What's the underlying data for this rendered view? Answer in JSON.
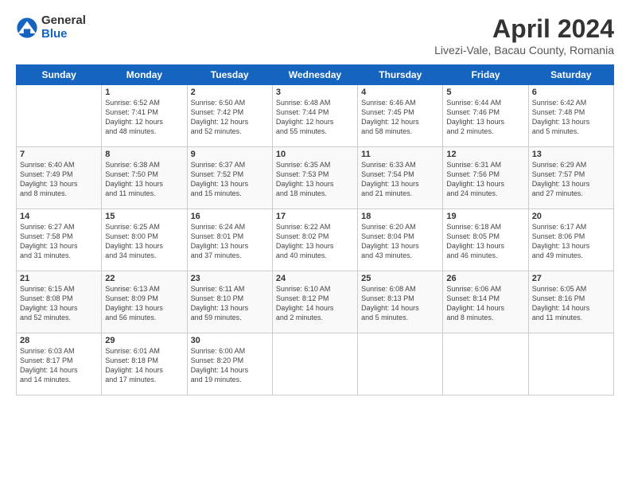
{
  "logo": {
    "general": "General",
    "blue": "Blue"
  },
  "title": "April 2024",
  "subtitle": "Livezi-Vale, Bacau County, Romania",
  "weekdays": [
    "Sunday",
    "Monday",
    "Tuesday",
    "Wednesday",
    "Thursday",
    "Friday",
    "Saturday"
  ],
  "weeks": [
    [
      {
        "day": "",
        "info": ""
      },
      {
        "day": "1",
        "info": "Sunrise: 6:52 AM\nSunset: 7:41 PM\nDaylight: 12 hours\nand 48 minutes."
      },
      {
        "day": "2",
        "info": "Sunrise: 6:50 AM\nSunset: 7:42 PM\nDaylight: 12 hours\nand 52 minutes."
      },
      {
        "day": "3",
        "info": "Sunrise: 6:48 AM\nSunset: 7:44 PM\nDaylight: 12 hours\nand 55 minutes."
      },
      {
        "day": "4",
        "info": "Sunrise: 6:46 AM\nSunset: 7:45 PM\nDaylight: 12 hours\nand 58 minutes."
      },
      {
        "day": "5",
        "info": "Sunrise: 6:44 AM\nSunset: 7:46 PM\nDaylight: 13 hours\nand 2 minutes."
      },
      {
        "day": "6",
        "info": "Sunrise: 6:42 AM\nSunset: 7:48 PM\nDaylight: 13 hours\nand 5 minutes."
      }
    ],
    [
      {
        "day": "7",
        "info": "Sunrise: 6:40 AM\nSunset: 7:49 PM\nDaylight: 13 hours\nand 8 minutes."
      },
      {
        "day": "8",
        "info": "Sunrise: 6:38 AM\nSunset: 7:50 PM\nDaylight: 13 hours\nand 11 minutes."
      },
      {
        "day": "9",
        "info": "Sunrise: 6:37 AM\nSunset: 7:52 PM\nDaylight: 13 hours\nand 15 minutes."
      },
      {
        "day": "10",
        "info": "Sunrise: 6:35 AM\nSunset: 7:53 PM\nDaylight: 13 hours\nand 18 minutes."
      },
      {
        "day": "11",
        "info": "Sunrise: 6:33 AM\nSunset: 7:54 PM\nDaylight: 13 hours\nand 21 minutes."
      },
      {
        "day": "12",
        "info": "Sunrise: 6:31 AM\nSunset: 7:56 PM\nDaylight: 13 hours\nand 24 minutes."
      },
      {
        "day": "13",
        "info": "Sunrise: 6:29 AM\nSunset: 7:57 PM\nDaylight: 13 hours\nand 27 minutes."
      }
    ],
    [
      {
        "day": "14",
        "info": "Sunrise: 6:27 AM\nSunset: 7:58 PM\nDaylight: 13 hours\nand 31 minutes."
      },
      {
        "day": "15",
        "info": "Sunrise: 6:25 AM\nSunset: 8:00 PM\nDaylight: 13 hours\nand 34 minutes."
      },
      {
        "day": "16",
        "info": "Sunrise: 6:24 AM\nSunset: 8:01 PM\nDaylight: 13 hours\nand 37 minutes."
      },
      {
        "day": "17",
        "info": "Sunrise: 6:22 AM\nSunset: 8:02 PM\nDaylight: 13 hours\nand 40 minutes."
      },
      {
        "day": "18",
        "info": "Sunrise: 6:20 AM\nSunset: 8:04 PM\nDaylight: 13 hours\nand 43 minutes."
      },
      {
        "day": "19",
        "info": "Sunrise: 6:18 AM\nSunset: 8:05 PM\nDaylight: 13 hours\nand 46 minutes."
      },
      {
        "day": "20",
        "info": "Sunrise: 6:17 AM\nSunset: 8:06 PM\nDaylight: 13 hours\nand 49 minutes."
      }
    ],
    [
      {
        "day": "21",
        "info": "Sunrise: 6:15 AM\nSunset: 8:08 PM\nDaylight: 13 hours\nand 52 minutes."
      },
      {
        "day": "22",
        "info": "Sunrise: 6:13 AM\nSunset: 8:09 PM\nDaylight: 13 hours\nand 56 minutes."
      },
      {
        "day": "23",
        "info": "Sunrise: 6:11 AM\nSunset: 8:10 PM\nDaylight: 13 hours\nand 59 minutes."
      },
      {
        "day": "24",
        "info": "Sunrise: 6:10 AM\nSunset: 8:12 PM\nDaylight: 14 hours\nand 2 minutes."
      },
      {
        "day": "25",
        "info": "Sunrise: 6:08 AM\nSunset: 8:13 PM\nDaylight: 14 hours\nand 5 minutes."
      },
      {
        "day": "26",
        "info": "Sunrise: 6:06 AM\nSunset: 8:14 PM\nDaylight: 14 hours\nand 8 minutes."
      },
      {
        "day": "27",
        "info": "Sunrise: 6:05 AM\nSunset: 8:16 PM\nDaylight: 14 hours\nand 11 minutes."
      }
    ],
    [
      {
        "day": "28",
        "info": "Sunrise: 6:03 AM\nSunset: 8:17 PM\nDaylight: 14 hours\nand 14 minutes."
      },
      {
        "day": "29",
        "info": "Sunrise: 6:01 AM\nSunset: 8:18 PM\nDaylight: 14 hours\nand 17 minutes."
      },
      {
        "day": "30",
        "info": "Sunrise: 6:00 AM\nSunset: 8:20 PM\nDaylight: 14 hours\nand 19 minutes."
      },
      {
        "day": "",
        "info": ""
      },
      {
        "day": "",
        "info": ""
      },
      {
        "day": "",
        "info": ""
      },
      {
        "day": "",
        "info": ""
      }
    ]
  ]
}
